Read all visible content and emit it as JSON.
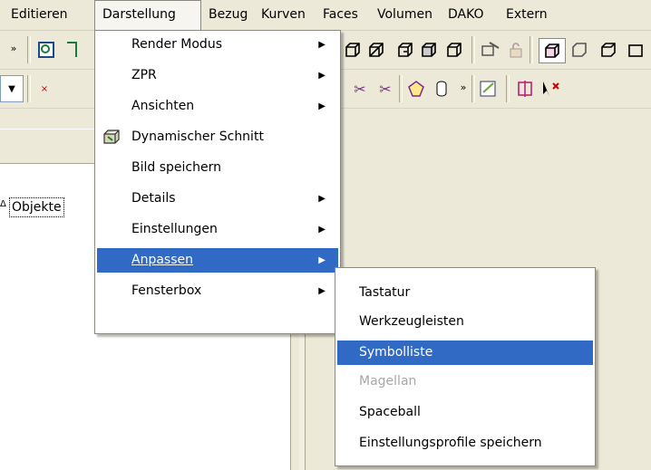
{
  "menubar": {
    "items": [
      {
        "label": "Editieren"
      },
      {
        "label": "Darstellung"
      },
      {
        "label": "Bezug"
      },
      {
        "label": "Kurven"
      },
      {
        "label": "Faces"
      },
      {
        "label": "Volumen"
      },
      {
        "label": "DAKO"
      },
      {
        "label": "Extern"
      }
    ]
  },
  "tree": {
    "objects_label": "Objekte"
  },
  "darstellung_menu": {
    "items": [
      {
        "label": "Render Modus",
        "submenu": true
      },
      {
        "label": "ZPR",
        "submenu": true
      },
      {
        "label": "Ansichten",
        "submenu": true
      },
      {
        "label": "Dynamischer Schnitt",
        "icon": "section-cube-icon"
      },
      {
        "label": "Bild speichern"
      },
      {
        "label": "Details",
        "submenu": true
      },
      {
        "label": "Einstellungen",
        "submenu": true
      },
      {
        "label": "Anpassen",
        "submenu": true,
        "selected": true
      },
      {
        "label": "Fensterbox",
        "submenu": true
      }
    ]
  },
  "anpassen_submenu": {
    "items": [
      {
        "label": "Tastatur"
      },
      {
        "label": "Werkzeugleisten"
      },
      {
        "label": "Symbolliste",
        "selected": true
      },
      {
        "label": "Magellan",
        "disabled": true
      },
      {
        "label": "Spaceball"
      },
      {
        "label": "Einstellungsprofile speichern"
      }
    ]
  },
  "colors": {
    "menu_selection": "#316ac5",
    "chrome": "#ece9d8",
    "disabled_text": "#a7a6aa"
  }
}
